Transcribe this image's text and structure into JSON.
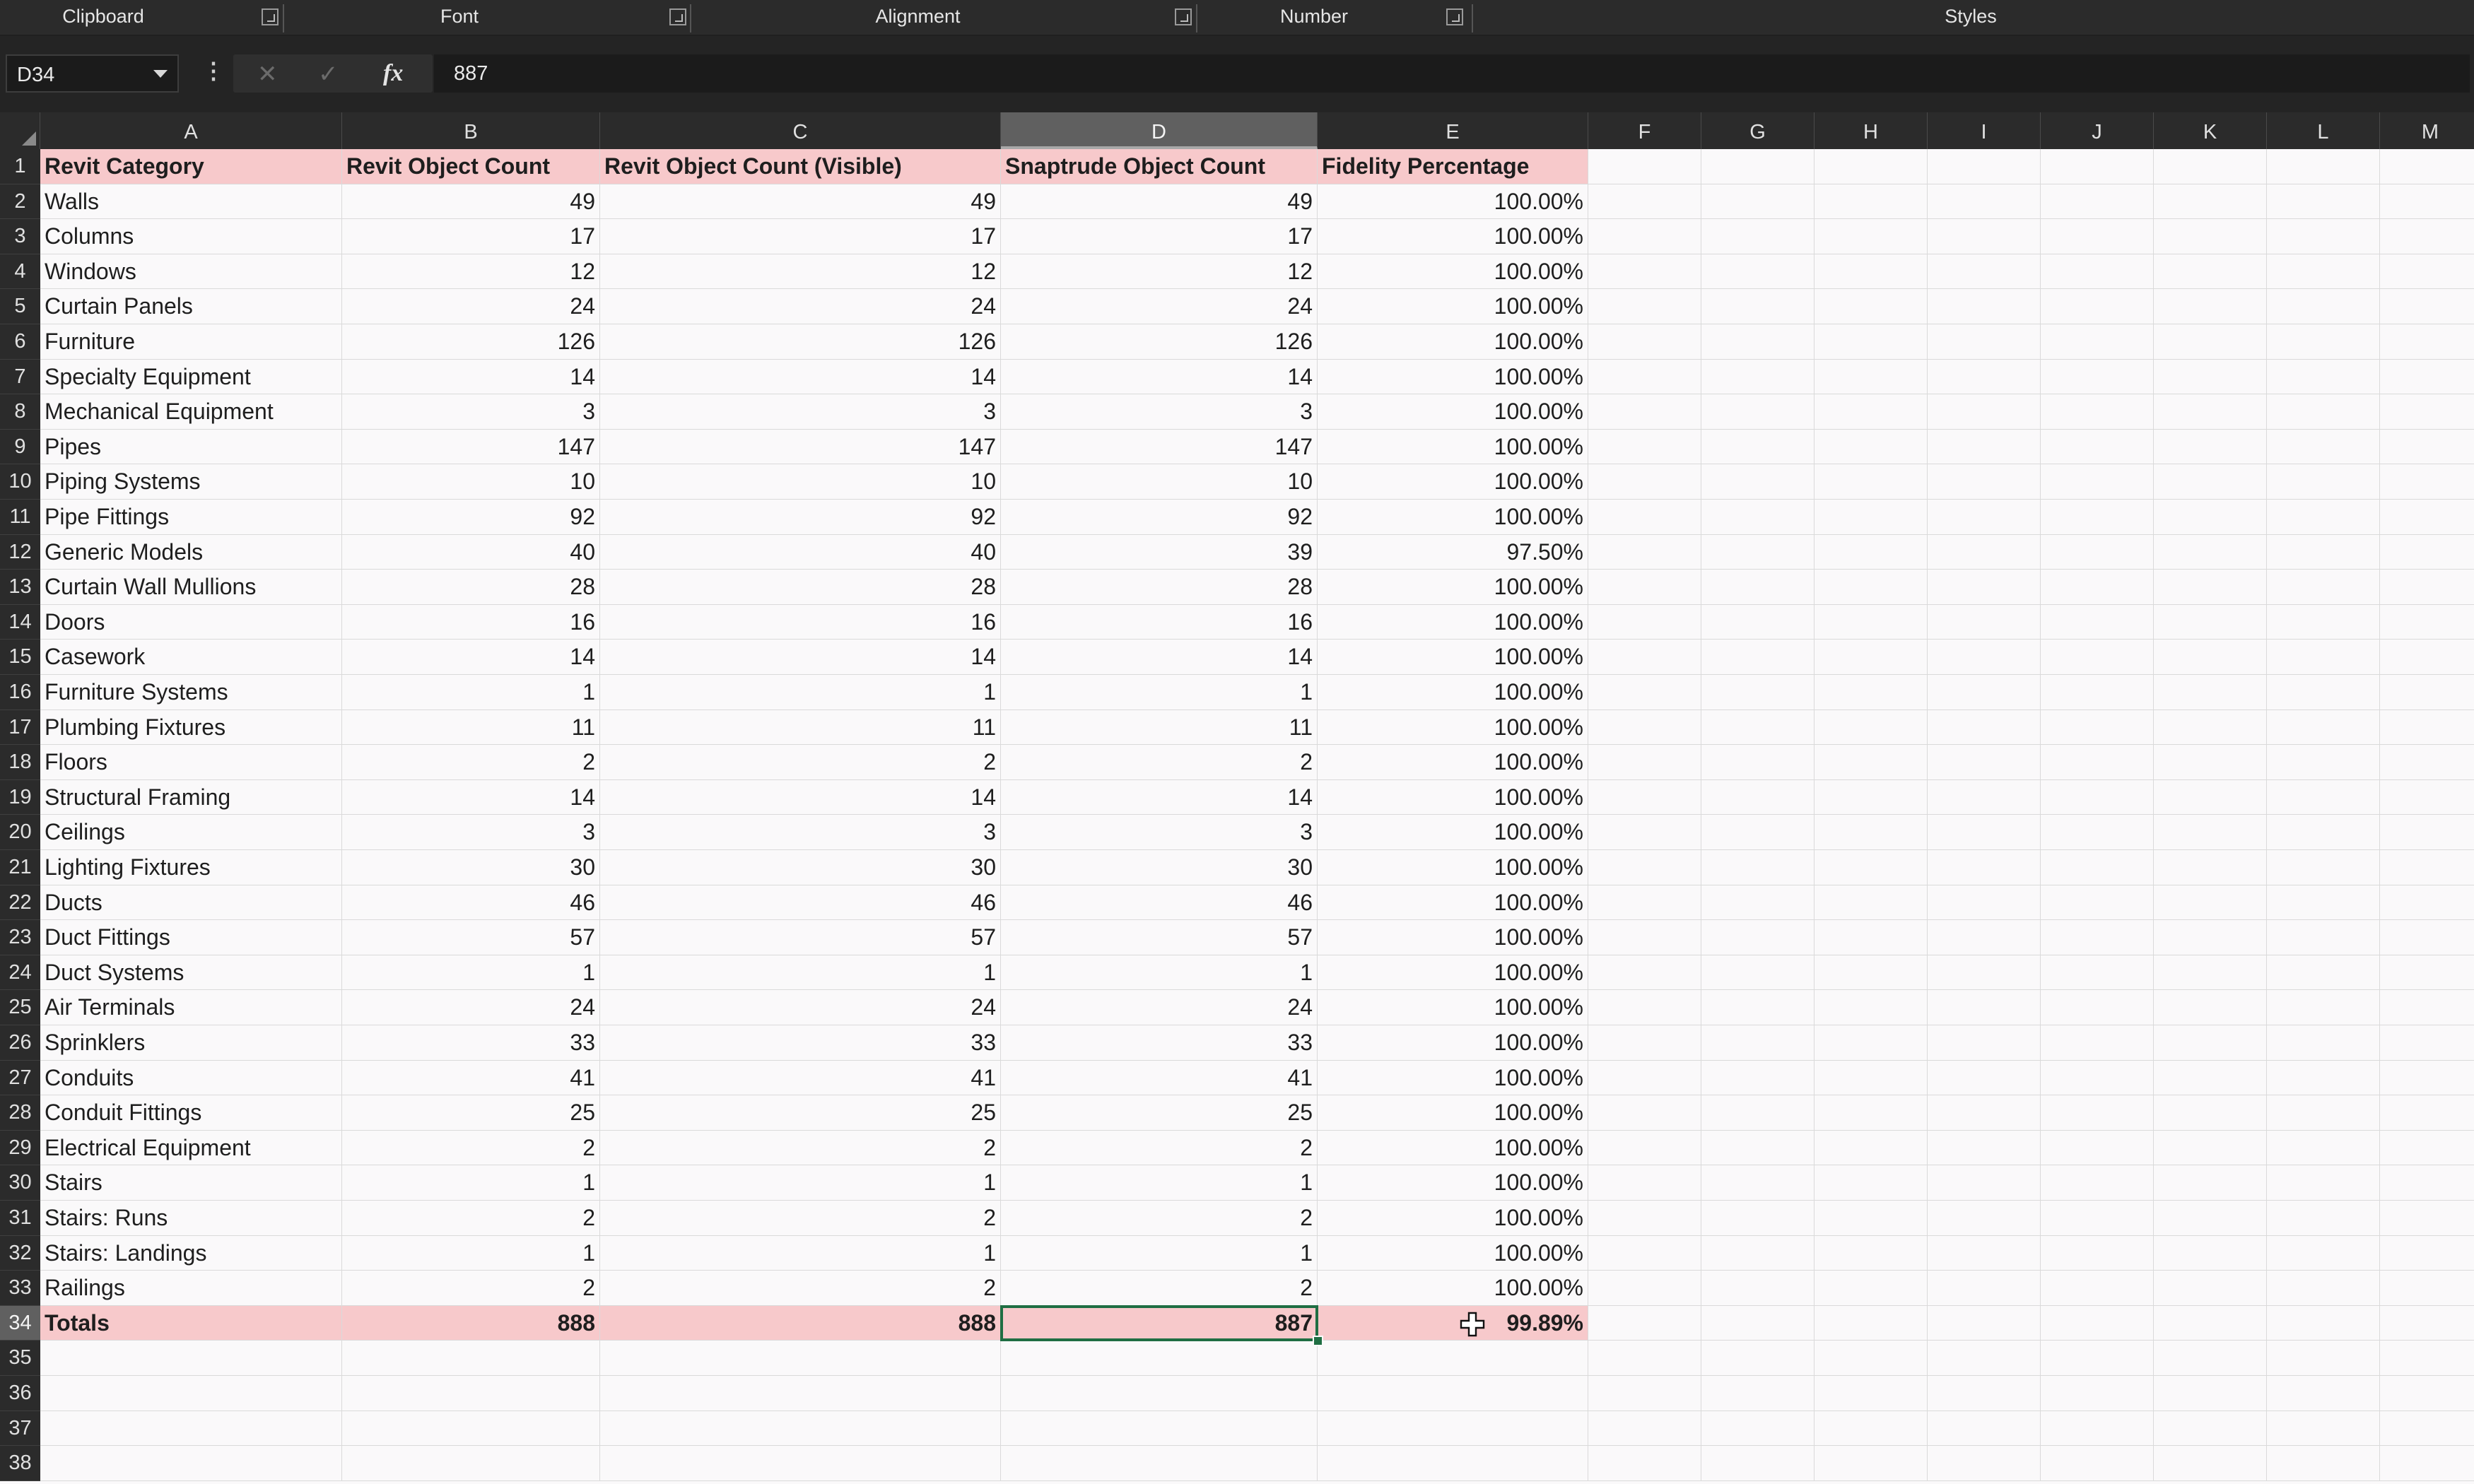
{
  "ribbon": {
    "groups": [
      {
        "label": "Clipboard"
      },
      {
        "label": "Font"
      },
      {
        "label": "Alignment"
      },
      {
        "label": "Number"
      },
      {
        "label": "Styles"
      }
    ]
  },
  "formula_bar": {
    "name_box": "D34",
    "cancel_icon": "✕",
    "enter_icon": "✓",
    "fx_label": "fx",
    "value": "887"
  },
  "columns": [
    "A",
    "B",
    "C",
    "D",
    "E",
    "F",
    "G",
    "H",
    "I",
    "J",
    "K",
    "L",
    "M"
  ],
  "selected_column": "D",
  "selected_row": 34,
  "row_numbers": [
    1,
    2,
    3,
    4,
    5,
    6,
    7,
    8,
    9,
    10,
    11,
    12,
    13,
    14,
    15,
    16,
    17,
    18,
    19,
    20,
    21,
    22,
    23,
    24,
    25,
    26,
    27,
    28,
    29,
    30,
    31,
    32,
    33,
    34,
    35,
    36,
    37,
    38
  ],
  "table": {
    "headers": [
      "Revit Category",
      "Revit Object Count",
      "Revit Object Count (Visible)",
      "Snaptrude Object Count",
      "Fidelity Percentage"
    ],
    "rows": [
      [
        "Walls",
        "49",
        "49",
        "49",
        "100.00%"
      ],
      [
        "Columns",
        "17",
        "17",
        "17",
        "100.00%"
      ],
      [
        "Windows",
        "12",
        "12",
        "12",
        "100.00%"
      ],
      [
        "Curtain Panels",
        "24",
        "24",
        "24",
        "100.00%"
      ],
      [
        "Furniture",
        "126",
        "126",
        "126",
        "100.00%"
      ],
      [
        "Specialty Equipment",
        "14",
        "14",
        "14",
        "100.00%"
      ],
      [
        "Mechanical Equipment",
        "3",
        "3",
        "3",
        "100.00%"
      ],
      [
        "Pipes",
        "147",
        "147",
        "147",
        "100.00%"
      ],
      [
        "Piping Systems",
        "10",
        "10",
        "10",
        "100.00%"
      ],
      [
        "Pipe Fittings",
        "92",
        "92",
        "92",
        "100.00%"
      ],
      [
        "Generic Models",
        "40",
        "40",
        "39",
        "97.50%"
      ],
      [
        "Curtain Wall Mullions",
        "28",
        "28",
        "28",
        "100.00%"
      ],
      [
        "Doors",
        "16",
        "16",
        "16",
        "100.00%"
      ],
      [
        "Casework",
        "14",
        "14",
        "14",
        "100.00%"
      ],
      [
        "Furniture Systems",
        "1",
        "1",
        "1",
        "100.00%"
      ],
      [
        "Plumbing Fixtures",
        "11",
        "11",
        "11",
        "100.00%"
      ],
      [
        "Floors",
        "2",
        "2",
        "2",
        "100.00%"
      ],
      [
        "Structural Framing",
        "14",
        "14",
        "14",
        "100.00%"
      ],
      [
        "Ceilings",
        "3",
        "3",
        "3",
        "100.00%"
      ],
      [
        "Lighting Fixtures",
        "30",
        "30",
        "30",
        "100.00%"
      ],
      [
        "Ducts",
        "46",
        "46",
        "46",
        "100.00%"
      ],
      [
        "Duct Fittings",
        "57",
        "57",
        "57",
        "100.00%"
      ],
      [
        "Duct Systems",
        "1",
        "1",
        "1",
        "100.00%"
      ],
      [
        "Air Terminals",
        "24",
        "24",
        "24",
        "100.00%"
      ],
      [
        "Sprinklers",
        "33",
        "33",
        "33",
        "100.00%"
      ],
      [
        "Conduits",
        "41",
        "41",
        "41",
        "100.00%"
      ],
      [
        "Conduit Fittings",
        "25",
        "25",
        "25",
        "100.00%"
      ],
      [
        "Electrical Equipment",
        "2",
        "2",
        "2",
        "100.00%"
      ],
      [
        "Stairs",
        "1",
        "1",
        "1",
        "100.00%"
      ],
      [
        "Stairs: Runs",
        "2",
        "2",
        "2",
        "100.00%"
      ],
      [
        "Stairs: Landings",
        "1",
        "1",
        "1",
        "100.00%"
      ],
      [
        "Railings",
        "2",
        "2",
        "2",
        "100.00%"
      ]
    ],
    "totals": [
      "Totals",
      "888",
      "888",
      "887",
      "99.89%"
    ]
  },
  "colors": {
    "header_fill": "#f7c9cb",
    "selection": "#1f6e43",
    "dark_chrome": "#2b2b2b"
  }
}
